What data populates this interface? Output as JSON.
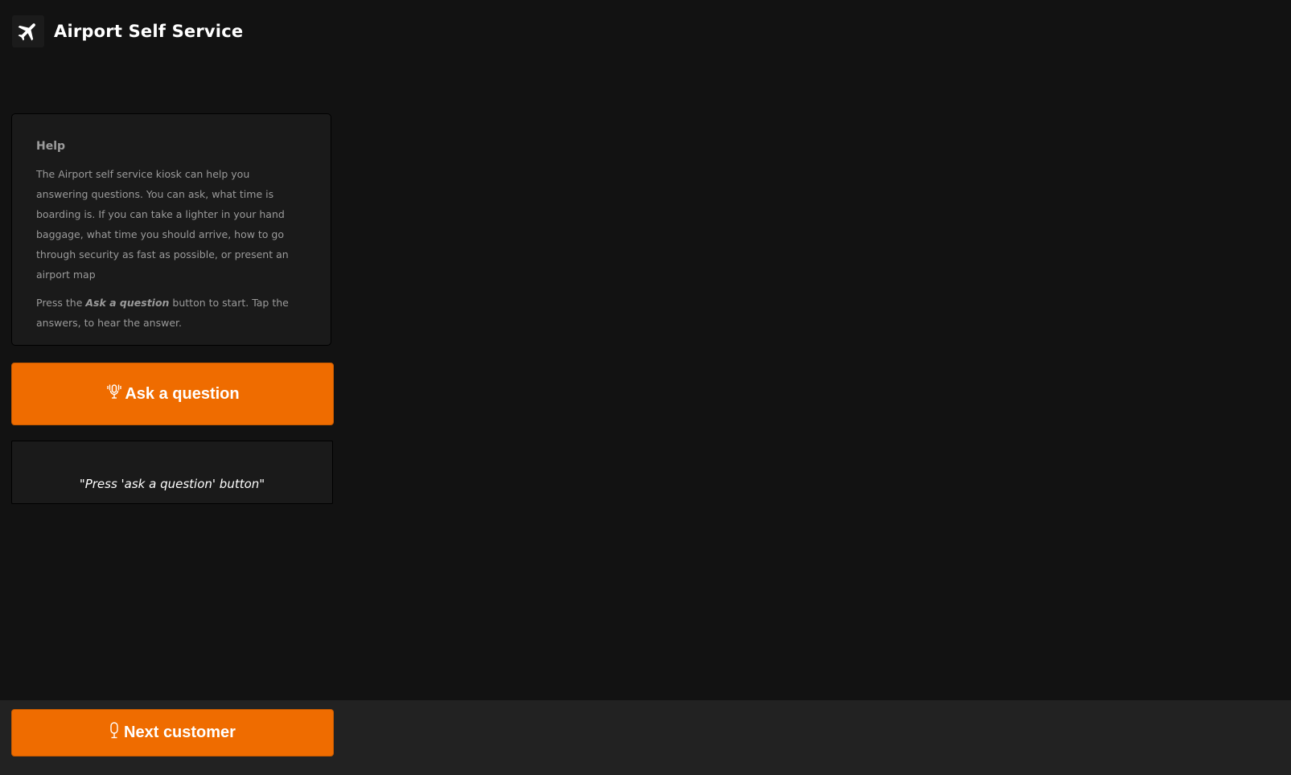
{
  "app": {
    "title": "Airport Self Service",
    "logo_icon": "airplane-icon"
  },
  "help": {
    "title": "Help",
    "paragraph1": "The Airport self service kiosk can help you answering questions. You can ask, what time is boarding is. If you can take a lighter in your hand baggage, what time you should arrive, how to go through security as fast as possible, or present an airport map",
    "paragraph2_prefix": "Press the ",
    "paragraph2_emphasis": "Ask a question",
    "paragraph2_suffix": " button to start. Tap the answers, to hear the answer."
  },
  "ask_button": {
    "label": "Ask a question",
    "icon": "microphone-waves-icon"
  },
  "transcript": {
    "text": "\"Press 'ask a question' button\""
  },
  "next_button": {
    "label": "Next customer",
    "icon": "microphone-icon"
  },
  "colors": {
    "background": "#121212",
    "card": "#1a1a1a",
    "accent": "#ef6c00",
    "footer": "#222222"
  }
}
